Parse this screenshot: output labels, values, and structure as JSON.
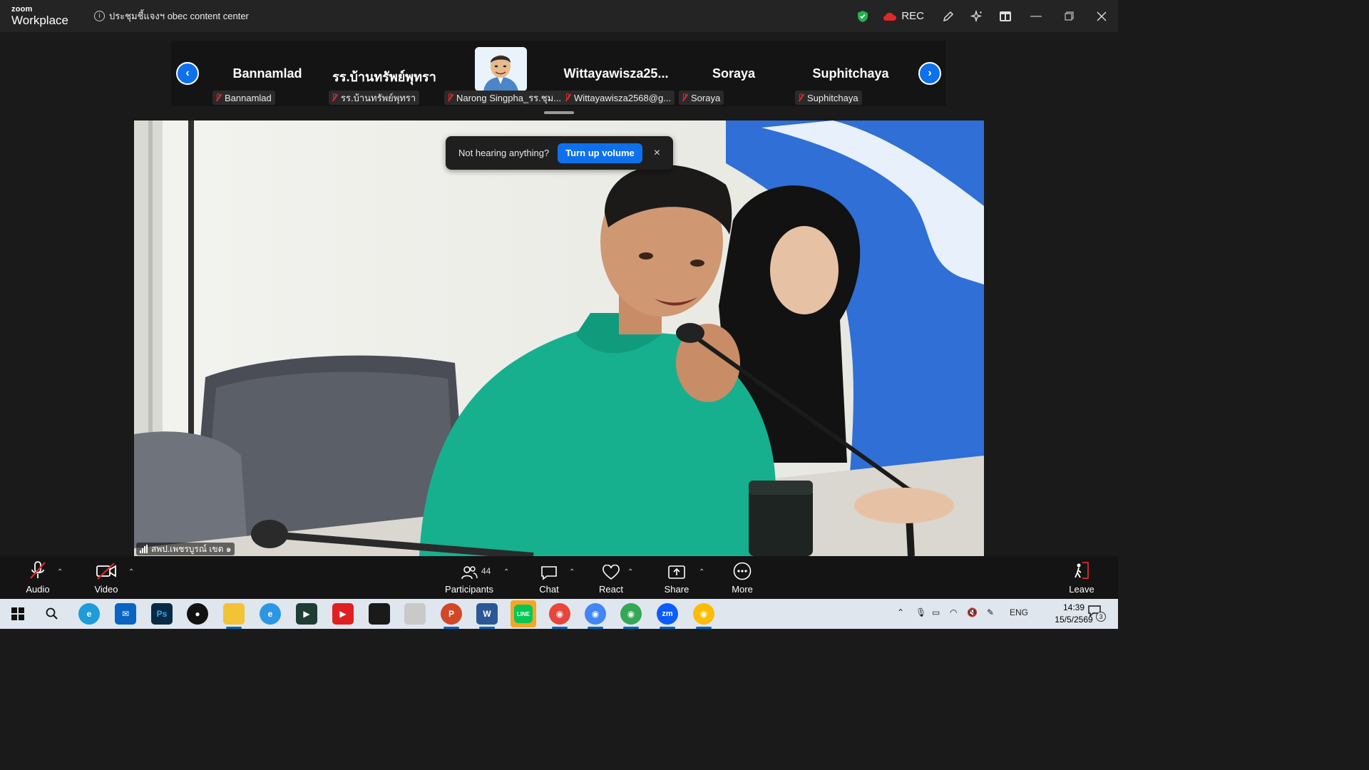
{
  "titlebar": {
    "brand_top": "zoom",
    "brand_bottom": "Workplace",
    "meeting_title": "ประชุมชี้แจงฯ obec content center",
    "rec_label": "REC"
  },
  "strip": {
    "participants": [
      {
        "name": "Bannamlad",
        "label": "Bannamlad"
      },
      {
        "name": "รร.บ้านทรัพย์พุทรา",
        "label": "รร.บ้านทรัพย์พุทรา"
      },
      {
        "name": "",
        "label": "Narong Singpha_รร.ชุม..."
      },
      {
        "name": "Wittayawisza25...",
        "label": "Wittayawisza2568@g..."
      },
      {
        "name": "Soraya",
        "label": "Soraya"
      },
      {
        "name": "Suphitchaya",
        "label": "Suphitchaya"
      }
    ]
  },
  "toast": {
    "message": "Not hearing anything?",
    "button": "Turn up volume",
    "close": "×"
  },
  "video": {
    "speaker_label": "สพป.เพชรบูรณ์ เขต ๑"
  },
  "toolbar": {
    "audio": "Audio",
    "video": "Video",
    "participants": "Participants",
    "participants_count": "44",
    "chat": "Chat",
    "react": "React",
    "share": "Share",
    "more": "More",
    "leave": "Leave"
  },
  "taskbar": {
    "language": "ENG",
    "time": "14:39",
    "date": "15/5/2569",
    "notification_count": "3",
    "apps": [
      "windows-start",
      "search",
      "edge",
      "mail",
      "photoshop",
      "maps",
      "file-explorer",
      "internet-explorer",
      "kinemaster",
      "youtube",
      "sticky-notes",
      "paint",
      "powerpoint",
      "word",
      "line",
      "chrome",
      "chrome",
      "chrome",
      "zoom",
      "chrome"
    ]
  },
  "colors": {
    "accent": "#0e71eb",
    "muted_red": "#e02828",
    "shield_green": "#22b14c"
  }
}
